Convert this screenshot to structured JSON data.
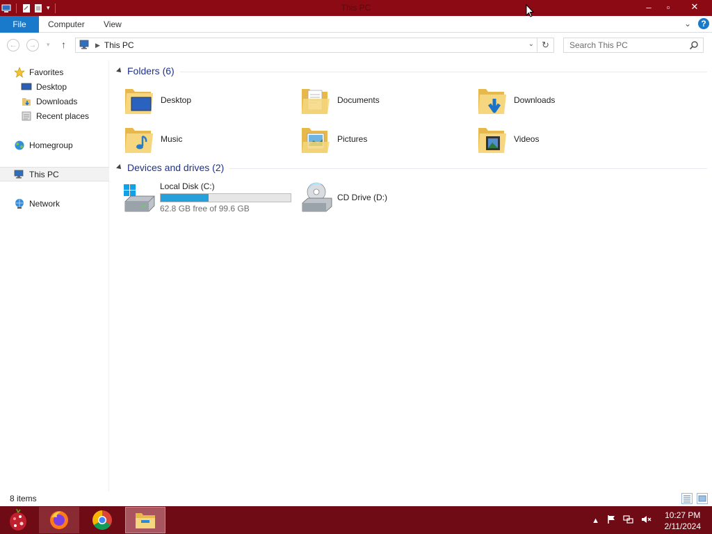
{
  "window": {
    "title": "This PC"
  },
  "ribbon": {
    "tabs": [
      {
        "label": "File"
      },
      {
        "label": "Computer"
      },
      {
        "label": "View"
      }
    ]
  },
  "address": {
    "path": [
      "This PC"
    ],
    "search_placeholder": "Search This PC"
  },
  "sidebar": {
    "items": [
      {
        "label": "Favorites",
        "icon": "star-icon"
      },
      {
        "label": "Desktop",
        "icon": "desktop-icon"
      },
      {
        "label": "Downloads",
        "icon": "downloads-icon"
      },
      {
        "label": "Recent places",
        "icon": "recent-places-icon"
      },
      {
        "label": "Homegroup",
        "icon": "homegroup-icon"
      },
      {
        "label": "This PC",
        "icon": "computer-icon",
        "selected": true
      },
      {
        "label": "Network",
        "icon": "network-icon"
      }
    ]
  },
  "groups": {
    "folders": {
      "title": "Folders (6)",
      "items": [
        {
          "label": "Desktop",
          "icon": "desktop-folder-icon"
        },
        {
          "label": "Documents",
          "icon": "documents-folder-icon"
        },
        {
          "label": "Downloads",
          "icon": "downloads-folder-icon"
        },
        {
          "label": "Music",
          "icon": "music-folder-icon"
        },
        {
          "label": "Pictures",
          "icon": "pictures-folder-icon"
        },
        {
          "label": "Videos",
          "icon": "videos-folder-icon"
        }
      ]
    },
    "drives": {
      "title": "Devices and drives (2)",
      "items": [
        {
          "label": "Local Disk (C:)",
          "free_text": "62.8 GB free of 99.6 GB",
          "used_fraction": 0.37,
          "icon": "hard-drive-icon"
        },
        {
          "label": "CD Drive (D:)",
          "icon": "cd-drive-icon"
        }
      ]
    }
  },
  "status": {
    "item_count": "8 items"
  },
  "taskbar": {
    "apps": [
      {
        "name": "firefox-icon"
      },
      {
        "name": "chrome-icon"
      },
      {
        "name": "file-explorer-icon"
      }
    ],
    "time": "10:27 PM",
    "date": "2/11/2024"
  },
  "colors": {
    "titlebar": "#8b0a14",
    "taskbar": "#6e0b14",
    "accent": "#1979ca",
    "group_title": "#1e3287",
    "progress": "#26a0da"
  }
}
